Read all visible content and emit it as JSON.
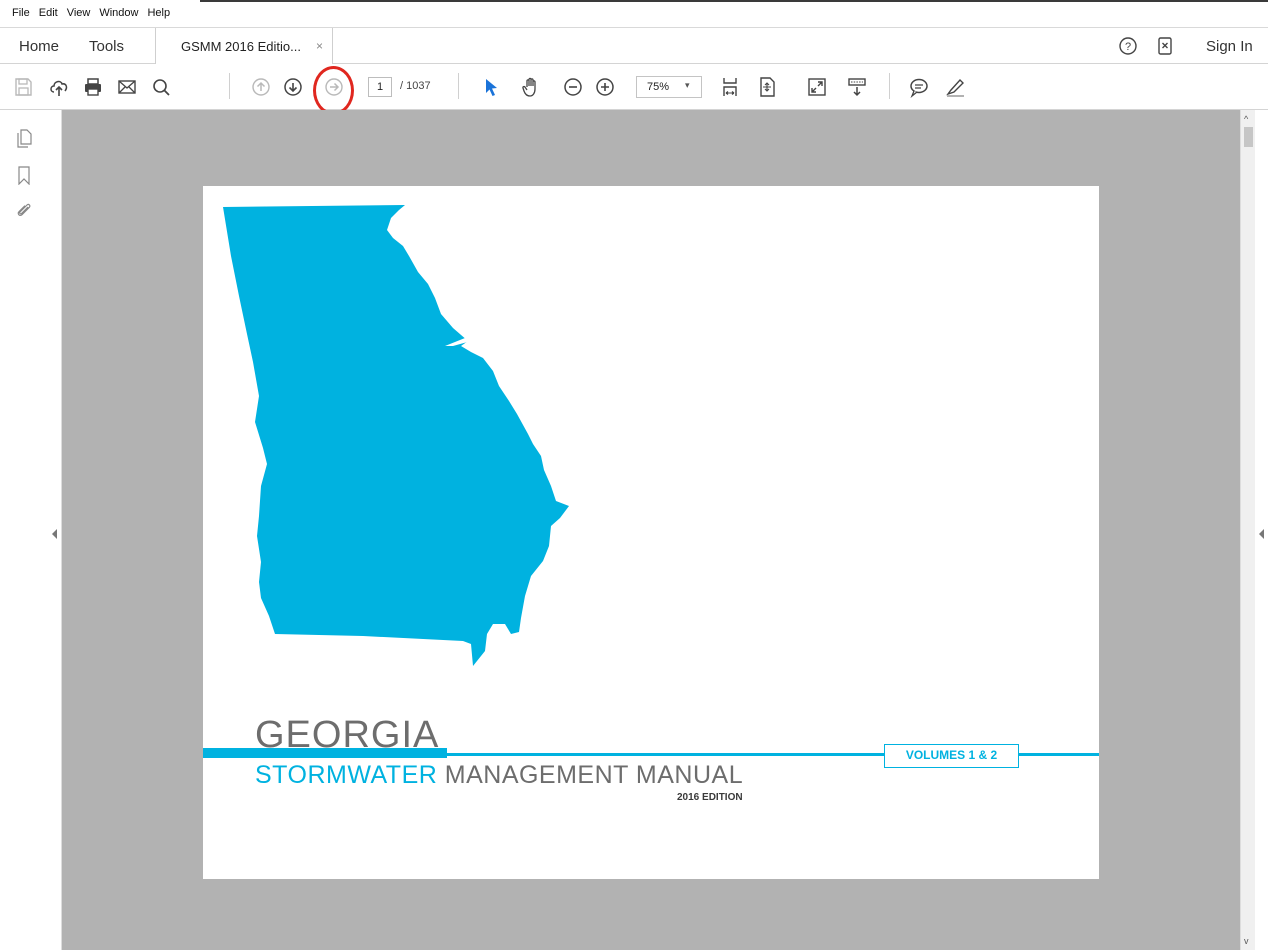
{
  "menu": {
    "items": [
      "File",
      "Edit",
      "View",
      "Window",
      "Help"
    ]
  },
  "tabs": {
    "home": "Home",
    "tools": "Tools",
    "document": "GSMM 2016 Editio...",
    "close": "×",
    "sign_in": "Sign In"
  },
  "toolbar": {
    "current_page": "1",
    "page_total": "/ 1037",
    "zoom": "75%",
    "zoom_arrow": "▾"
  },
  "document": {
    "title_line1": "GEORGIA",
    "title_word_blue": "STORMWATER",
    "title_word_gray": " MANAGEMENT MANUAL",
    "edition": "2016 EDITION",
    "volumes": "VOLUMES 1 & 2"
  },
  "scroll": {
    "up": "^",
    "down": "v"
  },
  "colors": {
    "accent_blue": "#00b2e0",
    "highlight_red": "#e0271f"
  },
  "icons": [
    "save-icon",
    "upload-icon",
    "print-icon",
    "email-icon",
    "search-icon",
    "prev-page-icon",
    "next-page-icon",
    "goto-page-icon",
    "select-cursor-icon",
    "hand-icon",
    "zoom-out-icon",
    "zoom-in-icon",
    "fit-width-icon",
    "fit-page-icon",
    "fullscreen-icon",
    "scroll-mode-icon",
    "comment-icon",
    "highlight-icon",
    "help-icon",
    "mobile-link-icon",
    "pages-panel-icon",
    "bookmark-icon",
    "attachment-icon"
  ]
}
